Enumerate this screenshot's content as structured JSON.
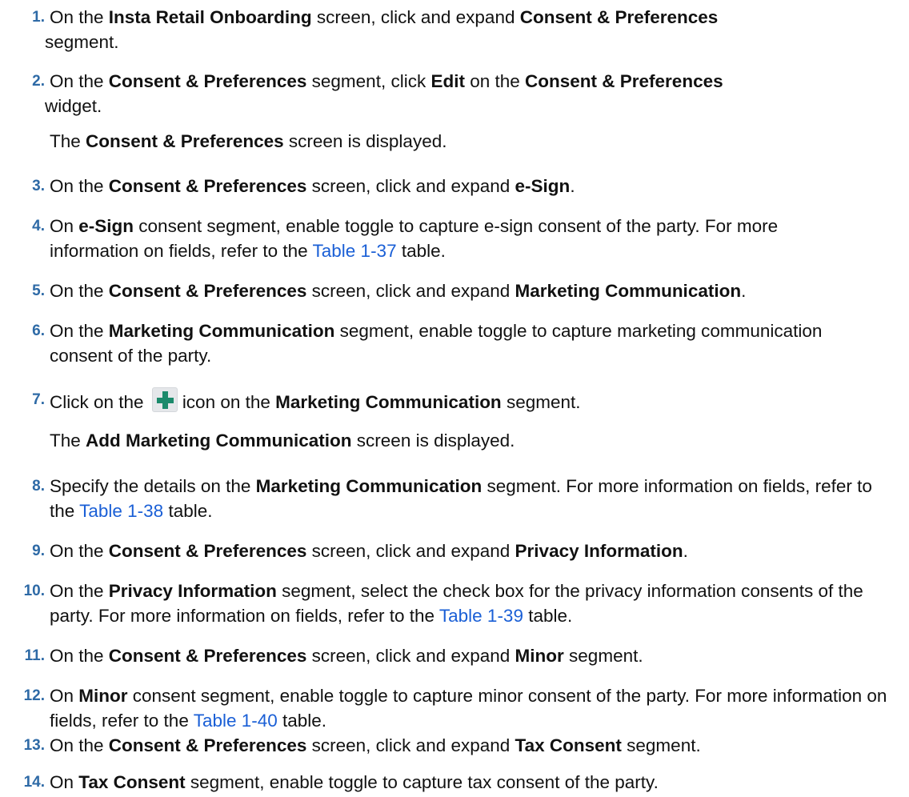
{
  "steps": [
    {
      "number": "1.",
      "parts": [
        {
          "t": "On the "
        },
        {
          "b": "Insta Retail Onboarding"
        },
        {
          "t": " screen, click and expand "
        },
        {
          "b": "Consent & Preferences"
        },
        {
          "t": " segment."
        }
      ]
    },
    {
      "number": "2.",
      "parts": [
        {
          "t": "On the "
        },
        {
          "b": "Consent & Preferences"
        },
        {
          "t": " segment, click "
        },
        {
          "b": "Edit"
        },
        {
          "t": " on the "
        },
        {
          "b": "Consent & Preferences"
        },
        {
          "t": " widget."
        }
      ],
      "note": [
        {
          "t": "The "
        },
        {
          "b": "Consent & Preferences"
        },
        {
          "t": " screen is displayed."
        }
      ]
    },
    {
      "number": "3.",
      "parts": [
        {
          "t": "On the "
        },
        {
          "b": "Consent & Preferences"
        },
        {
          "t": " screen, click and expand "
        },
        {
          "b": "e-Sign"
        },
        {
          "t": "."
        }
      ]
    },
    {
      "number": "4.",
      "parts": [
        {
          "t": "On "
        },
        {
          "b": "e-Sign"
        },
        {
          "t": " consent segment, enable toggle to capture e-sign consent of the party. For more information on fields, refer to the "
        },
        {
          "link": "Table 1-37"
        },
        {
          "t": " table."
        }
      ]
    },
    {
      "number": "5.",
      "parts": [
        {
          "t": "On the "
        },
        {
          "b": "Consent & Preferences"
        },
        {
          "t": " screen, click and expand "
        },
        {
          "b": "Marketing Communication"
        },
        {
          "t": "."
        }
      ]
    },
    {
      "number": "6.",
      "parts": [
        {
          "t": "On the "
        },
        {
          "b": "Marketing Communication"
        },
        {
          "t": " segment, enable toggle to capture marketing communication consent of the party."
        }
      ]
    },
    {
      "number": "7.",
      "parts": [
        {
          "t": "Click on the "
        },
        {
          "icon": "plus-icon"
        },
        {
          "t": "icon on the "
        },
        {
          "b": "Marketing Communication"
        },
        {
          "t": " segment."
        }
      ],
      "note": [
        {
          "t": "The "
        },
        {
          "b": "Add Marketing Communication"
        },
        {
          "t": " screen is displayed."
        }
      ]
    },
    {
      "number": "8.",
      "parts": [
        {
          "t": "Specify the details on the "
        },
        {
          "b": "Marketing Communication"
        },
        {
          "t": " segment. For more information on fields, refer to the "
        },
        {
          "link": "Table 1-38"
        },
        {
          "t": " table."
        }
      ]
    },
    {
      "number": "9.",
      "parts": [
        {
          "t": "On the "
        },
        {
          "b": "Consent & Preferences"
        },
        {
          "t": " screen, click and expand "
        },
        {
          "b": "Privacy Information"
        },
        {
          "t": "."
        }
      ]
    },
    {
      "number": "10.",
      "parts": [
        {
          "t": "On the "
        },
        {
          "b": "Privacy Information"
        },
        {
          "t": " segment, select the check box for the privacy information consents of the party. For more information on fields, refer to the "
        },
        {
          "link": "Table 1-39"
        },
        {
          "t": " table."
        }
      ]
    },
    {
      "number": "11.",
      "parts": [
        {
          "t": "On the "
        },
        {
          "b": "Consent & Preferences"
        },
        {
          "t": " screen, click and expand "
        },
        {
          "b": "Minor"
        },
        {
          "t": " segment."
        }
      ]
    },
    {
      "number": "12.",
      "parts": [
        {
          "t": "On "
        },
        {
          "b": "Minor"
        },
        {
          "t": " consent segment, enable toggle to capture minor consent of the party. For more information on fields, refer to the "
        },
        {
          "link": "Table 1-40"
        },
        {
          "t": " table."
        }
      ]
    },
    {
      "number": "13.",
      "parts": [
        {
          "t": "On the "
        },
        {
          "b": "Consent & Preferences"
        },
        {
          "t": " screen, click and expand "
        },
        {
          "b": "Tax Consent"
        },
        {
          "t": " segment."
        }
      ]
    },
    {
      "number": "14.",
      "parts": [
        {
          "t": "On "
        },
        {
          "b": "Tax Consent"
        },
        {
          "t": " segment, enable toggle to capture tax consent of the party."
        }
      ]
    }
  ],
  "colors": {
    "step_number": "#2e6aa6",
    "link": "#1a5fd6",
    "plus_icon": "#1b8a6b"
  }
}
